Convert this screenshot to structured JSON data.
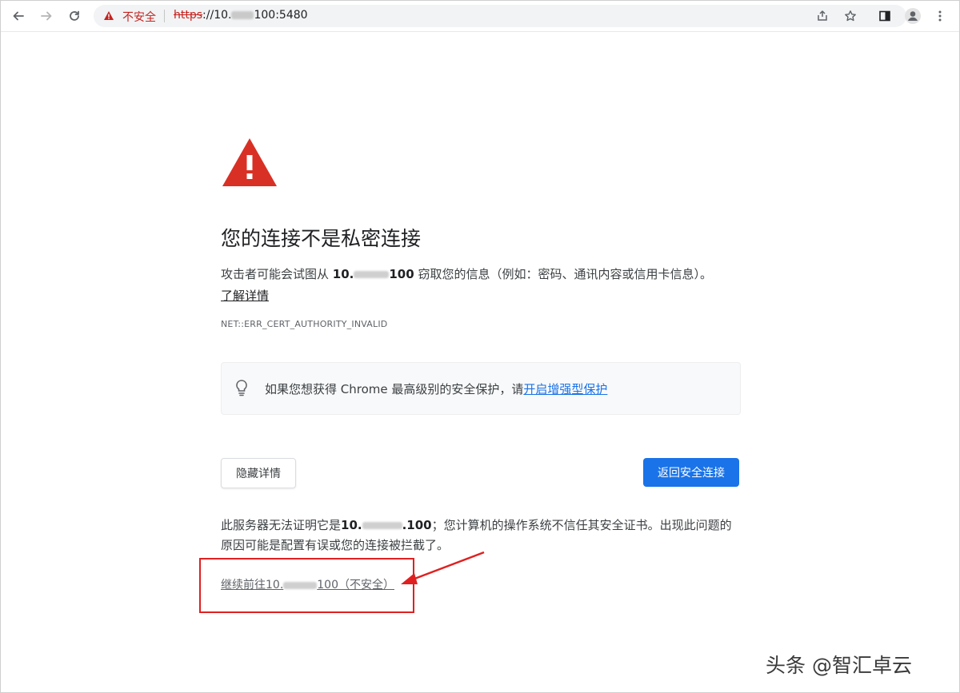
{
  "toolbar": {
    "insecure_label": "不安全",
    "url_scheme": "https",
    "url_prefix": "://10.",
    "url_suffix": "100:5480"
  },
  "interstitial": {
    "title": "您的连接不是私密连接",
    "desc_part1": "攻击者可能会试图从 ",
    "desc_host_a": "10.",
    "desc_host_b": "100",
    "desc_part2": " 窃取您的信息（例如：密码、通讯内容或信用卡信息）。",
    "learn_more": "了解详情",
    "error_code": "NET::ERR_CERT_AUTHORITY_INVALID",
    "tip_text": "如果您想获得 Chrome 最高级别的安全保护，请",
    "tip_link": "开启增强型保护",
    "hide_details_button": "隐藏详情",
    "back_to_safety_button": "返回安全连接",
    "details_part1": "此服务器无法证明它是",
    "details_host_a": "10.",
    "details_host_b": ".100",
    "details_part2": "；您计算机的操作系统不信任其安全证书。出现此问题的原因可能是配置有误或您的连接被拦截了。",
    "proceed_a": "继续前往10.",
    "proceed_b": "100（不安全）"
  },
  "watermark": "头条 @智汇卓云",
  "colors": {
    "danger": "#c5221f",
    "warning_triangle": "#d93025",
    "primary": "#1a73e8",
    "annotation": "#e02020"
  }
}
